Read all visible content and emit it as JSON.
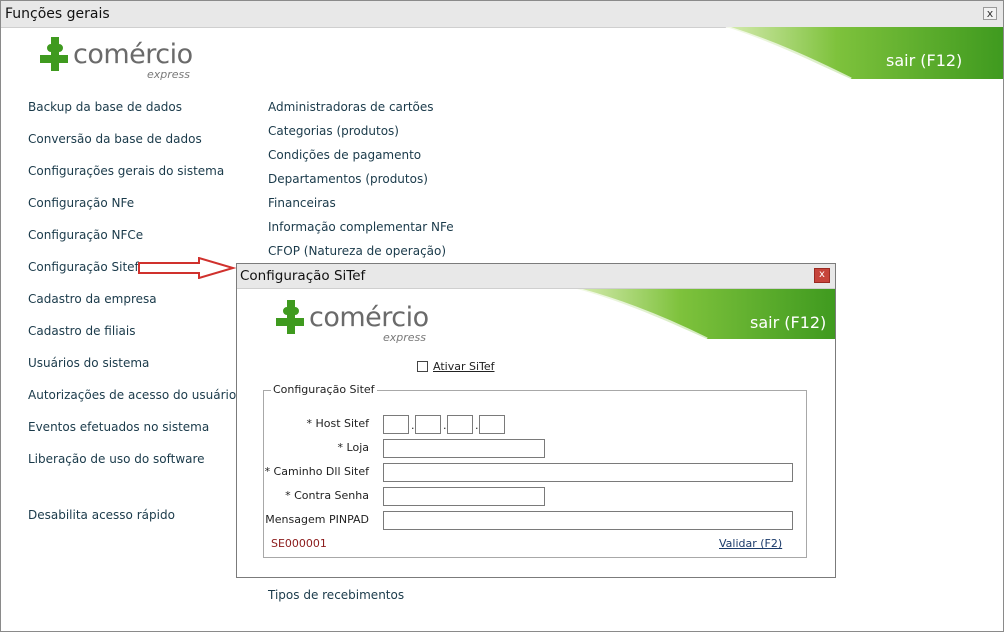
{
  "window": {
    "title": "Funções gerais",
    "close": "x"
  },
  "brand": {
    "name": "comércio",
    "tagline": "express",
    "exit": "sair (F12)",
    "green": "#5aa829"
  },
  "left_menu": [
    "Backup da base de dados",
    "Conversão da base de dados",
    "Configurações gerais do sistema",
    "Configuração NFe",
    "Configuração NFCe",
    "Configuração Sitef",
    "Cadastro da empresa",
    "Cadastro de filiais",
    "Usuários do sistema",
    "Autorizações de acesso do usuário",
    "Eventos efetuados no sistema",
    "Liberação de uso do software",
    "Desabilita acesso rápido"
  ],
  "right_menu": [
    "Administradoras de cartões",
    "Categorias   (produtos)",
    "Condições de pagamento",
    "Departamentos   (produtos)",
    "Financeiras",
    "Informação complementar NFe",
    "CFOP   (Natureza de operação)",
    "Tipos de recebimentos"
  ],
  "dialog": {
    "title": "Configuração SiTef",
    "close": "x",
    "ativar_label": "Ativar SiTef",
    "ativar_checked": false,
    "group_label": "Configuração Sitef",
    "host_label": "* Host Sitef",
    "host_dots": [
      ".",
      " .",
      "."
    ],
    "loja_label": "* Loja",
    "caminho_label": "* Caminho Dll Sitef",
    "senha_label": "* Contra Senha",
    "pinpad_label": "Mensagem PINPAD",
    "code": "SE000001",
    "validar": "Validar (F2)"
  },
  "colors": {
    "arrow": "#d0312d",
    "code_text": "#8b1a1a",
    "link_text": "#1a3a4a"
  }
}
